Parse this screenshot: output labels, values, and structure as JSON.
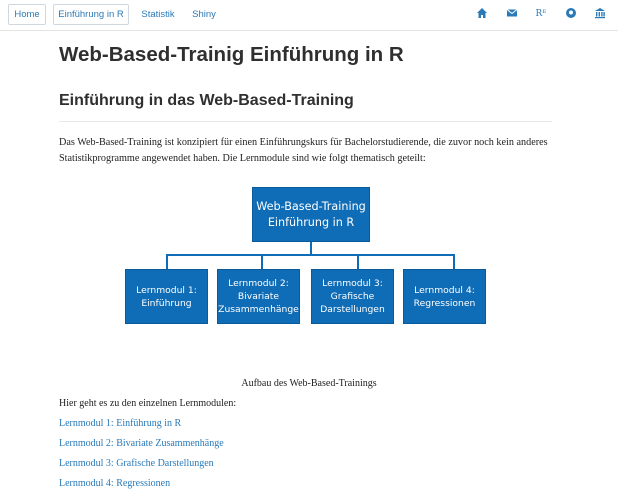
{
  "nav": {
    "home": "Home",
    "einfuehrung": "Einführung in R",
    "statistik": "Statistik",
    "shiny": "Shiny",
    "icons": [
      "home-icon",
      "mail-icon",
      "r-icon",
      "github-icon",
      "bank-icon"
    ],
    "r_label": "Rᴱ"
  },
  "page": {
    "title": "Web-Based-Trainig Einführung in R",
    "section_title": "Einführung in das Web-Based-Training",
    "intro": "Das Web-Based-Training ist konzipiert für einen Einführungskurs für Bachelorstudierende, die zuvor noch kein anderes Statistikprogramme angewendet haben. Die Lernmodule sind wie folgt thematisch geteilt:"
  },
  "diagram": {
    "root": "Web-Based-Training\nEinführung in R",
    "modules": [
      "Lernmodul 1:\nEinführung",
      "Lernmodul 2:\nBivariate\nZusammenhänge",
      "Lernmodul 3:\nGrafische\nDarstellungen",
      "Lernmodul 4:\nRegressionen"
    ],
    "caption": "Aufbau des Web-Based-Trainings"
  },
  "links": {
    "lead": "Hier geht es zu den einzelnen Lernmodulen:",
    "items": [
      "Lernmodul 1: Einführung in R",
      "Lernmodul 2: Bivariate Zusammenhänge",
      "Lernmodul 3: Grafische Darstellungen",
      "Lernmodul 4: Regressionen"
    ]
  },
  "colors": {
    "accent": "#2a7ab8",
    "box": "#0f6cb6"
  }
}
